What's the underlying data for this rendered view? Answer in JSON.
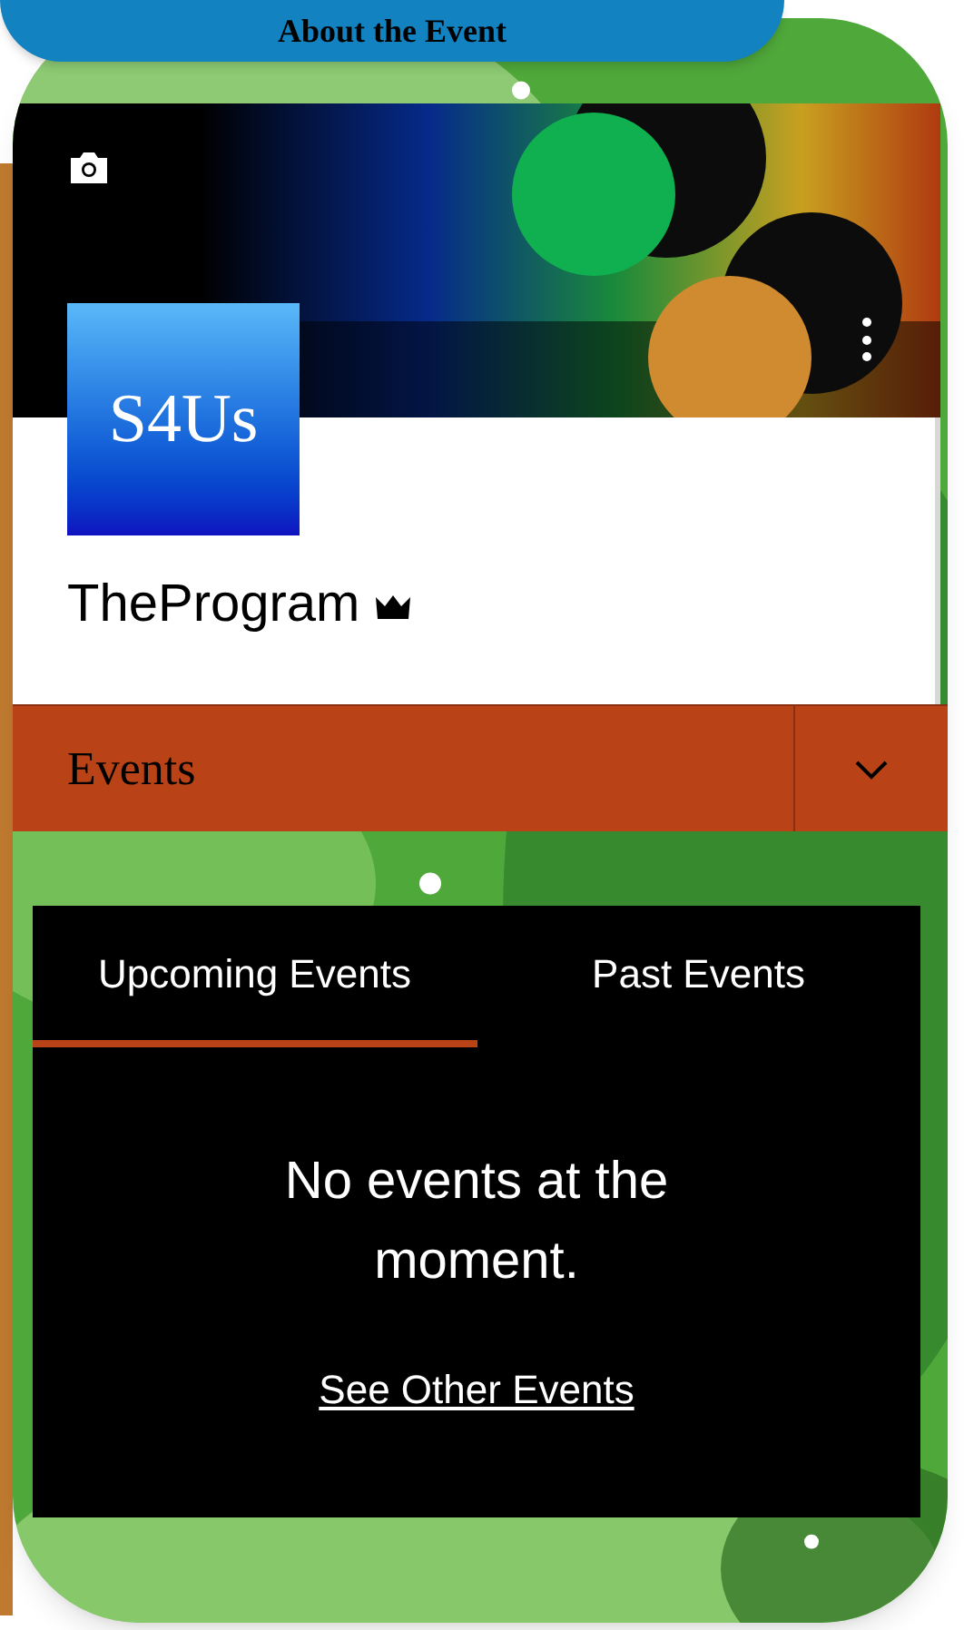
{
  "header_banner": {
    "title": "About the Event"
  },
  "profile": {
    "logo_text": "S4Us",
    "name": "TheProgram"
  },
  "section": {
    "title": "Events",
    "expanded": false
  },
  "tabs": [
    {
      "label": "Upcoming Events",
      "selected": true
    },
    {
      "label": "Past Events",
      "selected": false
    }
  ],
  "empty_state": {
    "message": "No events at the moment.",
    "link": "See Other Events"
  }
}
